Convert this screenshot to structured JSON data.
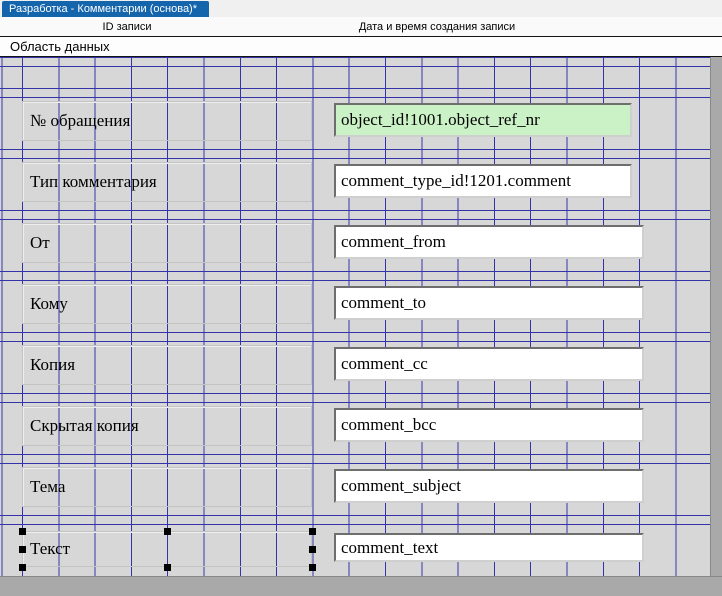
{
  "window": {
    "tab_title": "Разработка - Комментарии (основа)*"
  },
  "header": {
    "col1": "ID записи",
    "col2": "Дата и время создания записи"
  },
  "band": {
    "title": "Область данных"
  },
  "fields": [
    {
      "label": "№ обращения",
      "value": "object_id!1001.object_ref_nr",
      "highlight": true,
      "selected": false
    },
    {
      "label": "Тип комментария",
      "value": "comment_type_id!1201.comment",
      "highlight": false,
      "selected": false
    },
    {
      "label": "От",
      "value": "comment_from",
      "highlight": false,
      "selected": false
    },
    {
      "label": "Кому",
      "value": "comment_to",
      "highlight": false,
      "selected": false
    },
    {
      "label": "Копия",
      "value": "comment_cc",
      "highlight": false,
      "selected": false
    },
    {
      "label": "Скрытая копия",
      "value": "comment_bcc",
      "highlight": false,
      "selected": false
    },
    {
      "label": "Тема",
      "value": "comment_subject",
      "highlight": false,
      "selected": false
    },
    {
      "label": "Текст",
      "value": "comment_text",
      "highlight": false,
      "selected": true
    }
  ],
  "colors": {
    "tab_bg": "#1565ad",
    "highlight_field_bg": "#cbf2c6",
    "grid_line": "#3434a8",
    "selection_handle": "#000000"
  }
}
